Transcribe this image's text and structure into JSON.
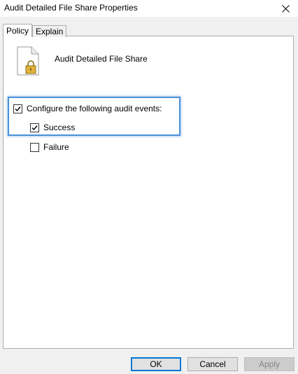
{
  "window": {
    "title": "Audit Detailed File Share Properties"
  },
  "tabs": [
    {
      "label": "Policy",
      "active": true
    },
    {
      "label": "Explain",
      "active": false
    }
  ],
  "policy": {
    "name": "Audit Detailed File Share",
    "icon": "locked-document-icon"
  },
  "options": {
    "configure": {
      "label": "Configure the following audit events:",
      "checked": true
    },
    "success": {
      "label": "Success",
      "checked": true
    },
    "failure": {
      "label": "Failure",
      "checked": false
    }
  },
  "buttons": {
    "ok": "OK",
    "cancel": "Cancel",
    "apply": "Apply"
  },
  "colors": {
    "highlight": "#4a90d9",
    "ok_border": "#0078d7"
  }
}
